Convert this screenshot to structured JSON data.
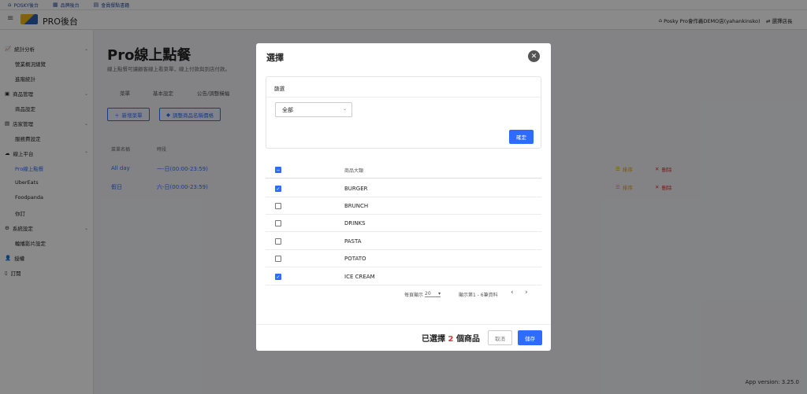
{
  "topbar": {
    "items": [
      "POSKY後台",
      "品牌後台",
      "會員餐點書籍"
    ]
  },
  "header": {
    "brand": "PRO後台",
    "store": "Posky Pro會作義DEMO店(yahankinsko)",
    "switch": "選擇店長"
  },
  "sidebar": {
    "items": [
      {
        "label": "統計分析",
        "icon": "chart-icon"
      },
      {
        "label": "營業概況總覽",
        "sub": true
      },
      {
        "label": "進階統計",
        "sub": true
      },
      {
        "label": "商品管理",
        "icon": "box-icon"
      },
      {
        "label": "商品設定",
        "sub": true
      },
      {
        "label": "店家管理",
        "icon": "store-icon"
      },
      {
        "label": "服務費設定",
        "sub": true
      },
      {
        "label": "線上平台",
        "icon": "cloud-icon"
      },
      {
        "label": "Pro線上點餐",
        "sub": true,
        "active": true
      },
      {
        "label": "UberEats",
        "sub": true
      },
      {
        "label": "Foodpanda",
        "sub": true
      },
      {
        "label": "你訂",
        "sub": true
      },
      {
        "label": "系統設定",
        "icon": "gear-icon"
      },
      {
        "label": "輪播影片設定",
        "sub": true
      },
      {
        "label": "授權",
        "icon": "user-icon"
      },
      {
        "label": "訂閱",
        "icon": "doc-icon"
      }
    ]
  },
  "page": {
    "title": "Pro線上點餐",
    "subtitle": "線上點餐可讓顧客線上看菜單，線上付款與到店付款。",
    "tabs": [
      "菜單",
      "基本設定",
      "公告/調整橫幅"
    ],
    "add_menu": "新增菜單",
    "adjust_price": "調整商品名稱價格",
    "columns": [
      "菜單名稱",
      "時段"
    ],
    "rows": [
      {
        "name": "All day",
        "time": "一-日(00:00-23:59)",
        "sort": "排序",
        "delete": "刪除"
      },
      {
        "name": "假日",
        "time": "六-日(00:00-23:59)",
        "sort": "排序",
        "delete": "刪除"
      }
    ]
  },
  "modal": {
    "title": "選擇",
    "filter_title": "篩選",
    "filter_value": "全部",
    "confirm": "確定",
    "column_header": "商品大類",
    "items": [
      {
        "label": "BURGER",
        "checked": true
      },
      {
        "label": "BRUNCH",
        "checked": false
      },
      {
        "label": "DRINKS",
        "checked": false
      },
      {
        "label": "PASTA",
        "checked": false
      },
      {
        "label": "POTATO",
        "checked": false
      },
      {
        "label": "ICE CREAM",
        "checked": true
      }
    ],
    "per_page_label": "每頁顯示",
    "per_page_value": "20",
    "range_text": "顯示第1 - 6筆資料",
    "selected_prefix": "已選擇",
    "selected_count": "2",
    "selected_suffix": "個商品",
    "cancel": "取消",
    "save": "儲存"
  },
  "version": "App version: 3.25.0"
}
